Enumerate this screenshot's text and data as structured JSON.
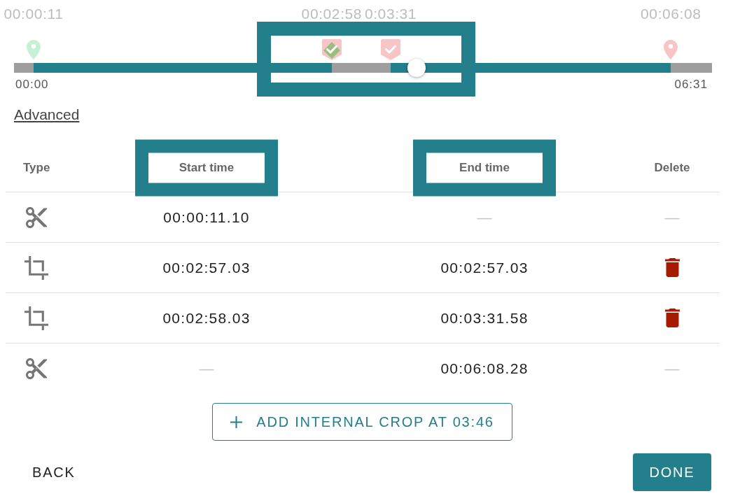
{
  "timeline": {
    "highlighted": true,
    "level": 0.577,
    "start_label": "00:00",
    "end_label": "06:31",
    "markers": [
      {
        "kind": "pin",
        "color": "#c8efd7",
        "label": "00:00:11"
      },
      {
        "kind": "flag",
        "color": "#f7c5c5",
        "label": "00:02:58",
        "highlighted": true
      },
      {
        "kind": "flag",
        "color": "#f7c5c5",
        "label": "0:03:31",
        "highlighted": false
      },
      {
        "kind": "pin",
        "color": "#f7c5c5",
        "label": "00:06:08"
      }
    ]
  },
  "advanced_link": "Advanced",
  "table": {
    "columns": [
      {
        "label": "Type",
        "highlighted": false
      },
      {
        "label": "Start time",
        "highlighted": true
      },
      {
        "label": "End time",
        "highlighted": true
      },
      {
        "label": "Delete",
        "highlighted": false
      }
    ],
    "rows": [
      {
        "kind": "cut",
        "start": {
          "text": "00:00:11.10",
          "muted": false
        },
        "end": {
          "text": "—",
          "muted": true
        },
        "deletable": false,
        "delete_text": "—"
      },
      {
        "kind": "crop",
        "start": {
          "text": "00:02:57.03",
          "muted": false
        },
        "end": {
          "text": "00:02:57.03",
          "muted": false
        },
        "deletable": true
      },
      {
        "kind": "crop",
        "start": {
          "text": "00:02:58.03",
          "muted": false
        },
        "end": {
          "text": "00:03:31.58",
          "muted": false
        },
        "deletable": true
      },
      {
        "kind": "cut",
        "start": {
          "text": "—",
          "muted": true
        },
        "end": {
          "text": "00:06:08.28",
          "muted": false
        },
        "deletable": false,
        "delete_text": "—"
      }
    ]
  },
  "add_button": {
    "label": "ADD INTERNAL CROP AT 03:46"
  },
  "back_button": "BACK",
  "done_button": "DONE"
}
